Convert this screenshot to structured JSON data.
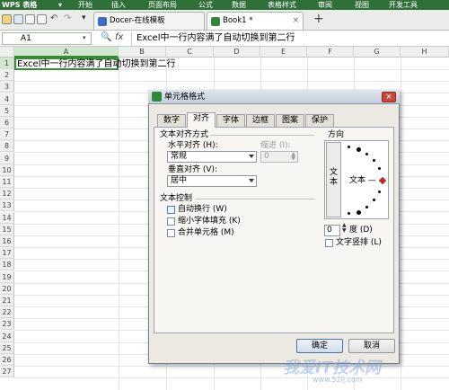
{
  "menubar": {
    "logo": "WPS 表格",
    "items": [
      "开始",
      "插入",
      "页面布局",
      "公式",
      "数据",
      "表格样式",
      "审阅",
      "视图",
      "开发工具"
    ]
  },
  "tabs": [
    {
      "label": "Docer-在线模板"
    },
    {
      "label": "Book1 *"
    }
  ],
  "formula_bar": {
    "name_box": "A1",
    "fx": "fx",
    "content": "Excel中一行内容满了自动切换到第二行"
  },
  "sheet": {
    "columns": [
      "A",
      "B",
      "C",
      "D",
      "E",
      "F",
      "G",
      "H"
    ],
    "rows": [
      "1",
      "2",
      "3",
      "4",
      "5",
      "6",
      "7",
      "8",
      "9",
      "10",
      "11",
      "12",
      "13",
      "14",
      "15",
      "16",
      "17",
      "18",
      "19",
      "20",
      "21",
      "22",
      "23",
      "24",
      "25",
      "26",
      "27"
    ],
    "a1": "Excel中一行内容满了自动切换到第二行"
  },
  "dialog": {
    "title": "单元格格式",
    "tabs": [
      "数字",
      "对齐",
      "字体",
      "边框",
      "图案",
      "保护"
    ],
    "active_tab": "对齐",
    "text_align_section": "文本对齐方式",
    "horizontal_label": "水平对齐 (H):",
    "horizontal_value": "常规",
    "indent_label": "缩进 (I):",
    "indent_value": "0",
    "vertical_label": "垂直对齐 (V):",
    "vertical_value": "居中",
    "text_control_section": "文本控制",
    "wrap_text": "自动换行 (W)",
    "shrink_to_fit": "缩小字体填充 (K)",
    "merge_cells": "合并单元格 (M)",
    "orientation_section": "方向",
    "vertical_text_button": "文本",
    "orientation_text": "文本 —",
    "degrees_value": "0",
    "degrees_label": "度 (D)",
    "stacked_text": "文字竖排 (L)",
    "ok": "确定",
    "cancel": "取消"
  },
  "watermark": {
    "main": "我爱IT技术网",
    "url": "www.52ij.com"
  }
}
